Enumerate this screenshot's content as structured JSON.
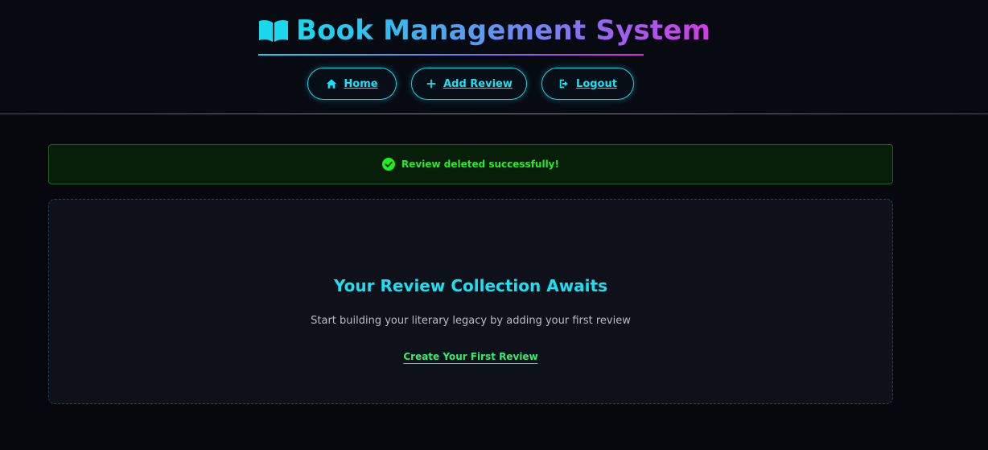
{
  "header": {
    "title": "Book Management System",
    "icon": "open-book-icon",
    "nav": [
      {
        "label": "Home",
        "icon": "home-icon"
      },
      {
        "label": "Add Review",
        "icon": "plus-icon"
      },
      {
        "label": "Logout",
        "icon": "logout-icon"
      }
    ]
  },
  "alert": {
    "message": "Review deleted successfully!",
    "icon": "check-circle-icon",
    "color": "#1ef01e"
  },
  "empty_state": {
    "title": "Your Review Collection Awaits",
    "subtitle": "Start building your literary legacy by adding your first review",
    "cta_label": "Create Your First Review"
  },
  "colors": {
    "accent": "#17e3f6",
    "success": "#1ef01e",
    "cta": "#2ff06b",
    "background": "#07080d"
  }
}
